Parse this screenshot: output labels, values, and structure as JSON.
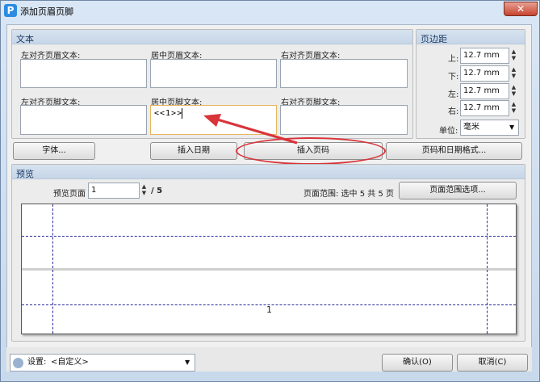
{
  "window": {
    "title": "添加页眉页脚",
    "app_icon_letter": "P",
    "close_symbol": "✕"
  },
  "text_group": {
    "title": "文本",
    "left_header_label": "左对齐页眉文本:",
    "center_header_label": "居中页眉文本:",
    "right_header_label": "右对齐页眉文本:",
    "left_footer_label": "左对齐页脚文本:",
    "center_footer_label": "居中页脚文本:",
    "right_footer_label": "右对齐页脚文本:",
    "center_footer_value": "<<1>>"
  },
  "margins_group": {
    "title": "页边距",
    "top_label": "上:",
    "top_value": "12.7 mm",
    "bottom_label": "下:",
    "bottom_value": "12.7 mm",
    "left_label": "左:",
    "left_value": "12.7 mm",
    "right_label": "右:",
    "right_value": "12.7 mm",
    "unit_label": "单位:",
    "unit_value": "毫米"
  },
  "buttons": {
    "font": "字体...",
    "insert_date": "插入日期",
    "insert_page_number": "插入页码",
    "page_date_format": "页码和日期格式..."
  },
  "preview_group": {
    "title": "预览",
    "preview_page_label": "预览页面",
    "preview_page_value": "1",
    "total_pages": "/ 5",
    "page_range_text": "页面范围: 选中 5 共 5 页",
    "page_range_options": "页面范围选项...",
    "footer_number": "1"
  },
  "bottom": {
    "settings_label": "设置:",
    "settings_value": "<自定义>",
    "ok": "确认(O)",
    "cancel": "取消(C)"
  },
  "colors": {
    "annotation_red": "#d8343a",
    "accent_blue": "#2b8be0"
  }
}
